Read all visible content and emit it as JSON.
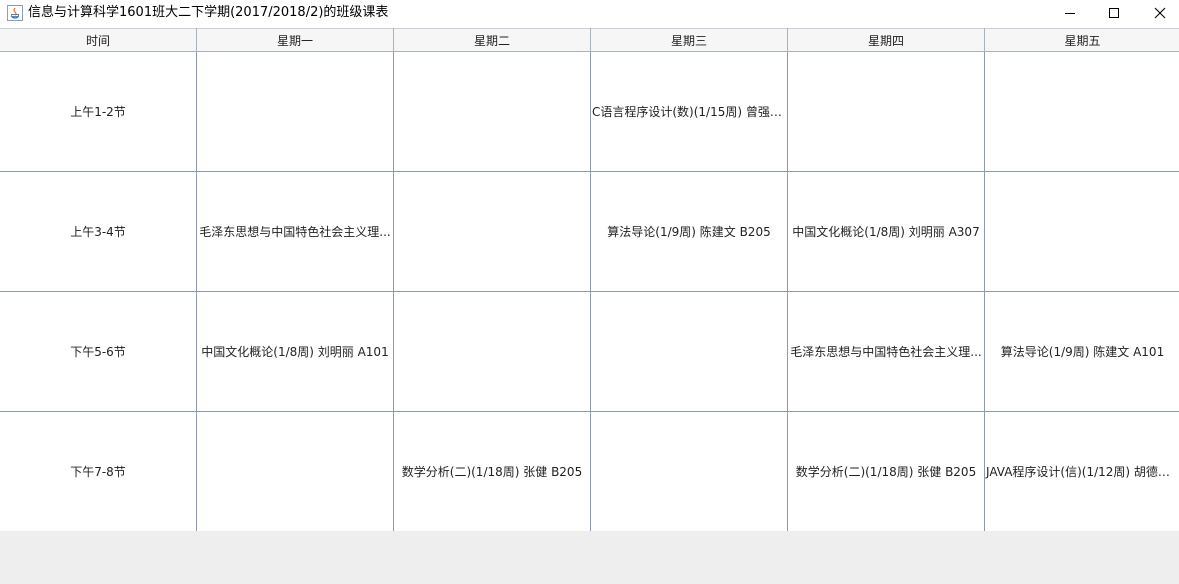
{
  "window": {
    "title": "信息与计算科学1601班大二下学期(2017/2018/2)的班级课表",
    "minimize_label": "—",
    "maximize_label": "☐",
    "close_label": "✕"
  },
  "table": {
    "headers": [
      "时间",
      "星期一",
      "星期二",
      "星期三",
      "星期四",
      "星期五"
    ],
    "rows": [
      {
        "time": "上午1-2节",
        "cells": [
          "",
          "",
          "C语言程序设计(数)(1/15周) 曾强聪...",
          "",
          ""
        ]
      },
      {
        "time": "上午3-4节",
        "cells": [
          "毛泽东思想与中国特色社会主义理...",
          "",
          "算法导论(1/9周) 陈建文 B205",
          "中国文化概论(1/8周) 刘明丽 A307",
          ""
        ]
      },
      {
        "time": "下午5-6节",
        "cells": [
          "中国文化概论(1/8周) 刘明丽 A101",
          "",
          "",
          "毛泽东思想与中国特色社会主义理...",
          "算法导论(1/9周) 陈建文 A101"
        ]
      },
      {
        "time": "下午7-8节",
        "cells": [
          "",
          "数学分析(二)(1/18周) 张健 B205",
          "",
          "数学分析(二)(1/18周) 张健 B205",
          "JAVA程序设计(信)(1/12周) 胡德发 ..."
        ]
      }
    ]
  }
}
